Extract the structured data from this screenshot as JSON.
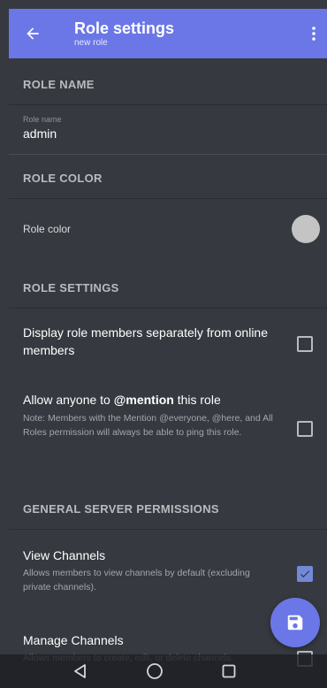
{
  "header": {
    "title": "Role settings",
    "subtitle": "new role"
  },
  "sections": {
    "role_name": "ROLE NAME",
    "role_color": "ROLE COLOR",
    "role_settings": "ROLE SETTINGS",
    "general_permissions": "GENERAL SERVER PERMISSIONS"
  },
  "role_name_field": {
    "label": "Role name",
    "value": "admin"
  },
  "role_color_row": {
    "label": "Role color",
    "swatch_color": "#c4c4c4"
  },
  "settings": [
    {
      "title": "Display role members separately from online members",
      "checked": false
    },
    {
      "title_prefix": "Allow anyone to ",
      "title_bold": "@mention",
      "title_suffix": " this role",
      "description": "Note: Members with the Mention @everyone, @here, and All Roles permission will always be able to ping this role.",
      "checked": false
    }
  ],
  "permissions": [
    {
      "title": "View Channels",
      "description": "Allows members to view channels by default (excluding private channels).",
      "checked": true
    },
    {
      "title": "Manage Channels",
      "description": "Allows members to create, edit, or delete channels.",
      "checked": false
    }
  ],
  "icons": {
    "back": "arrow-left-icon",
    "more": "more-vertical-icon",
    "save": "save-icon",
    "nav_back": "triangle-back-icon",
    "nav_home": "circle-home-icon",
    "nav_recents": "square-recents-icon"
  },
  "colors": {
    "accent": "#6b77e6",
    "background": "#36393f",
    "checkbox_checked": "#7289da"
  }
}
